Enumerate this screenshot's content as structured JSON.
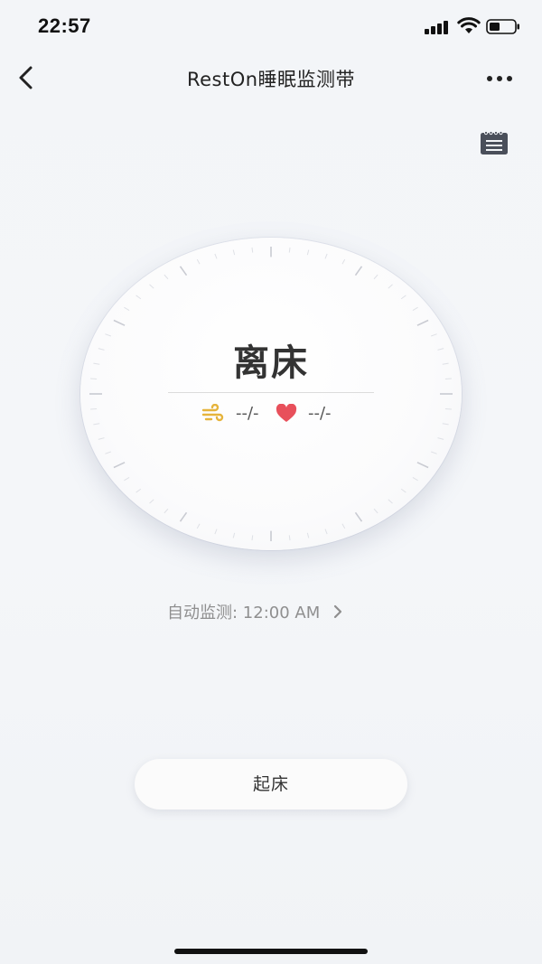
{
  "status_bar": {
    "time": "22:57"
  },
  "nav": {
    "title": "RestOn睡眠监测带"
  },
  "dial": {
    "status": "离床",
    "breath_value": "--/-",
    "heart_value": "--/-"
  },
  "auto_monitor": {
    "text": "自动监测: 12:00 AM"
  },
  "actions": {
    "wake_label": "起床"
  },
  "colors": {
    "breath_icon": "#e6b43c",
    "heart_icon": "#e8505b",
    "text_primary": "#333333",
    "text_secondary": "#8f8f8f"
  }
}
